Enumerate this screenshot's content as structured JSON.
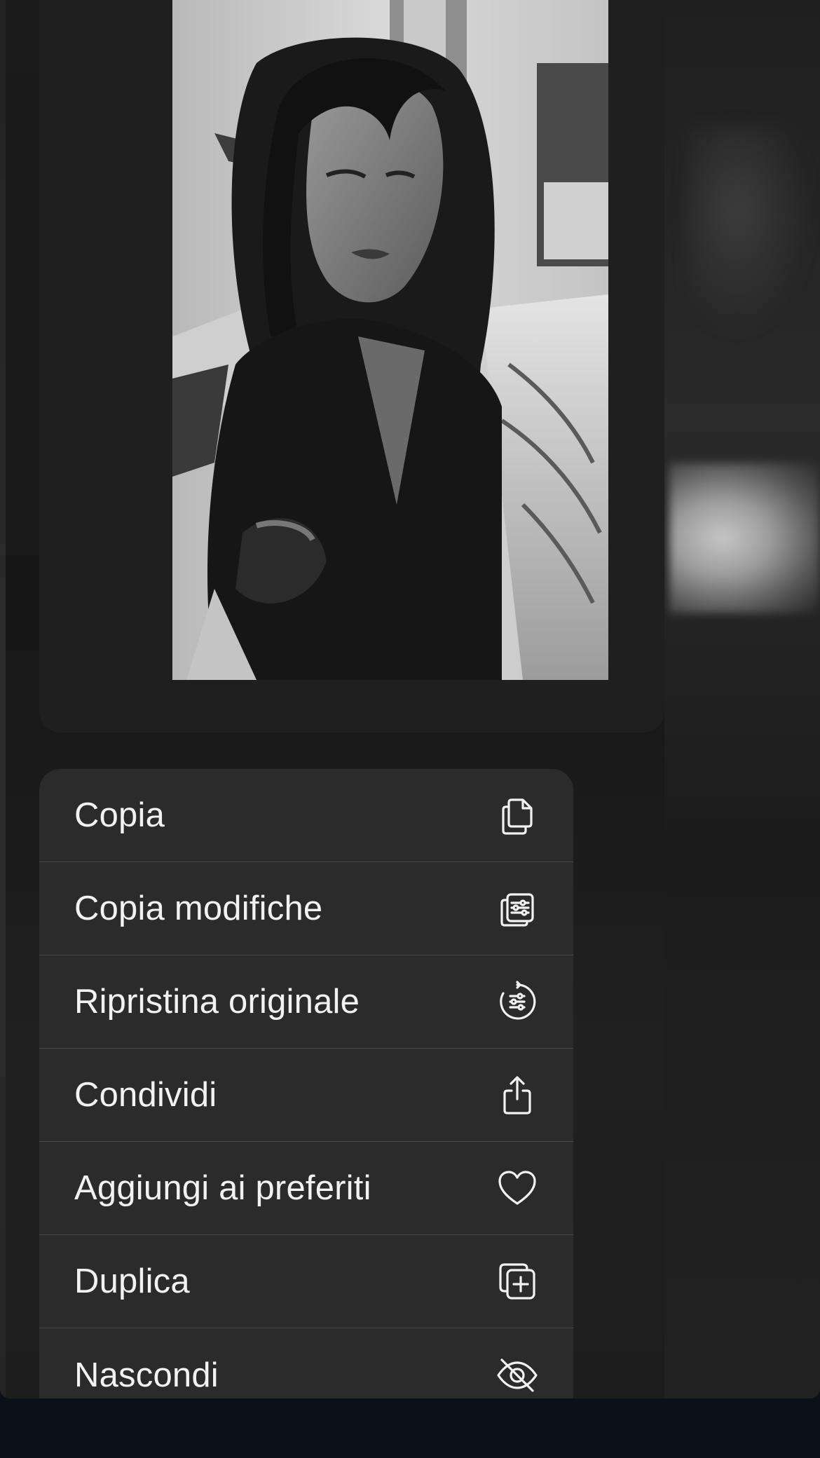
{
  "preview": {
    "description_icon": "photo-preview"
  },
  "menu": {
    "items": [
      {
        "label": "Copia",
        "icon": "copy-icon"
      },
      {
        "label": "Copia modifiche",
        "icon": "copy-edits-icon"
      },
      {
        "label": "Ripristina originale",
        "icon": "revert-icon"
      },
      {
        "label": "Condividi",
        "icon": "share-icon"
      },
      {
        "label": "Aggiungi ai preferiti",
        "icon": "heart-icon"
      },
      {
        "label": "Duplica",
        "icon": "duplicate-icon"
      },
      {
        "label": "Nascondi",
        "icon": "eye-slash-icon"
      }
    ]
  },
  "colors": {
    "menu_background": "#2b2b2b",
    "separator": "#474747",
    "text": "#f2f2f2",
    "bottom_bar": "#0b1019"
  }
}
